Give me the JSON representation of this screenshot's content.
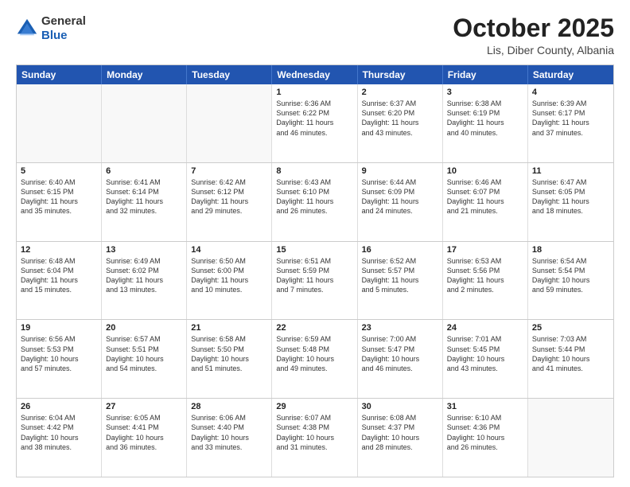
{
  "header": {
    "logo_general": "General",
    "logo_blue": "Blue",
    "month_title": "October 2025",
    "location": "Lis, Diber County, Albania"
  },
  "weekdays": [
    "Sunday",
    "Monday",
    "Tuesday",
    "Wednesday",
    "Thursday",
    "Friday",
    "Saturday"
  ],
  "rows": [
    [
      {
        "day": "",
        "text": ""
      },
      {
        "day": "",
        "text": ""
      },
      {
        "day": "",
        "text": ""
      },
      {
        "day": "1",
        "text": "Sunrise: 6:36 AM\nSunset: 6:22 PM\nDaylight: 11 hours\nand 46 minutes."
      },
      {
        "day": "2",
        "text": "Sunrise: 6:37 AM\nSunset: 6:20 PM\nDaylight: 11 hours\nand 43 minutes."
      },
      {
        "day": "3",
        "text": "Sunrise: 6:38 AM\nSunset: 6:19 PM\nDaylight: 11 hours\nand 40 minutes."
      },
      {
        "day": "4",
        "text": "Sunrise: 6:39 AM\nSunset: 6:17 PM\nDaylight: 11 hours\nand 37 minutes."
      }
    ],
    [
      {
        "day": "5",
        "text": "Sunrise: 6:40 AM\nSunset: 6:15 PM\nDaylight: 11 hours\nand 35 minutes."
      },
      {
        "day": "6",
        "text": "Sunrise: 6:41 AM\nSunset: 6:14 PM\nDaylight: 11 hours\nand 32 minutes."
      },
      {
        "day": "7",
        "text": "Sunrise: 6:42 AM\nSunset: 6:12 PM\nDaylight: 11 hours\nand 29 minutes."
      },
      {
        "day": "8",
        "text": "Sunrise: 6:43 AM\nSunset: 6:10 PM\nDaylight: 11 hours\nand 26 minutes."
      },
      {
        "day": "9",
        "text": "Sunrise: 6:44 AM\nSunset: 6:09 PM\nDaylight: 11 hours\nand 24 minutes."
      },
      {
        "day": "10",
        "text": "Sunrise: 6:46 AM\nSunset: 6:07 PM\nDaylight: 11 hours\nand 21 minutes."
      },
      {
        "day": "11",
        "text": "Sunrise: 6:47 AM\nSunset: 6:05 PM\nDaylight: 11 hours\nand 18 minutes."
      }
    ],
    [
      {
        "day": "12",
        "text": "Sunrise: 6:48 AM\nSunset: 6:04 PM\nDaylight: 11 hours\nand 15 minutes."
      },
      {
        "day": "13",
        "text": "Sunrise: 6:49 AM\nSunset: 6:02 PM\nDaylight: 11 hours\nand 13 minutes."
      },
      {
        "day": "14",
        "text": "Sunrise: 6:50 AM\nSunset: 6:00 PM\nDaylight: 11 hours\nand 10 minutes."
      },
      {
        "day": "15",
        "text": "Sunrise: 6:51 AM\nSunset: 5:59 PM\nDaylight: 11 hours\nand 7 minutes."
      },
      {
        "day": "16",
        "text": "Sunrise: 6:52 AM\nSunset: 5:57 PM\nDaylight: 11 hours\nand 5 minutes."
      },
      {
        "day": "17",
        "text": "Sunrise: 6:53 AM\nSunset: 5:56 PM\nDaylight: 11 hours\nand 2 minutes."
      },
      {
        "day": "18",
        "text": "Sunrise: 6:54 AM\nSunset: 5:54 PM\nDaylight: 10 hours\nand 59 minutes."
      }
    ],
    [
      {
        "day": "19",
        "text": "Sunrise: 6:56 AM\nSunset: 5:53 PM\nDaylight: 10 hours\nand 57 minutes."
      },
      {
        "day": "20",
        "text": "Sunrise: 6:57 AM\nSunset: 5:51 PM\nDaylight: 10 hours\nand 54 minutes."
      },
      {
        "day": "21",
        "text": "Sunrise: 6:58 AM\nSunset: 5:50 PM\nDaylight: 10 hours\nand 51 minutes."
      },
      {
        "day": "22",
        "text": "Sunrise: 6:59 AM\nSunset: 5:48 PM\nDaylight: 10 hours\nand 49 minutes."
      },
      {
        "day": "23",
        "text": "Sunrise: 7:00 AM\nSunset: 5:47 PM\nDaylight: 10 hours\nand 46 minutes."
      },
      {
        "day": "24",
        "text": "Sunrise: 7:01 AM\nSunset: 5:45 PM\nDaylight: 10 hours\nand 43 minutes."
      },
      {
        "day": "25",
        "text": "Sunrise: 7:03 AM\nSunset: 5:44 PM\nDaylight: 10 hours\nand 41 minutes."
      }
    ],
    [
      {
        "day": "26",
        "text": "Sunrise: 6:04 AM\nSunset: 4:42 PM\nDaylight: 10 hours\nand 38 minutes."
      },
      {
        "day": "27",
        "text": "Sunrise: 6:05 AM\nSunset: 4:41 PM\nDaylight: 10 hours\nand 36 minutes."
      },
      {
        "day": "28",
        "text": "Sunrise: 6:06 AM\nSunset: 4:40 PM\nDaylight: 10 hours\nand 33 minutes."
      },
      {
        "day": "29",
        "text": "Sunrise: 6:07 AM\nSunset: 4:38 PM\nDaylight: 10 hours\nand 31 minutes."
      },
      {
        "day": "30",
        "text": "Sunrise: 6:08 AM\nSunset: 4:37 PM\nDaylight: 10 hours\nand 28 minutes."
      },
      {
        "day": "31",
        "text": "Sunrise: 6:10 AM\nSunset: 4:36 PM\nDaylight: 10 hours\nand 26 minutes."
      },
      {
        "day": "",
        "text": ""
      }
    ]
  ]
}
